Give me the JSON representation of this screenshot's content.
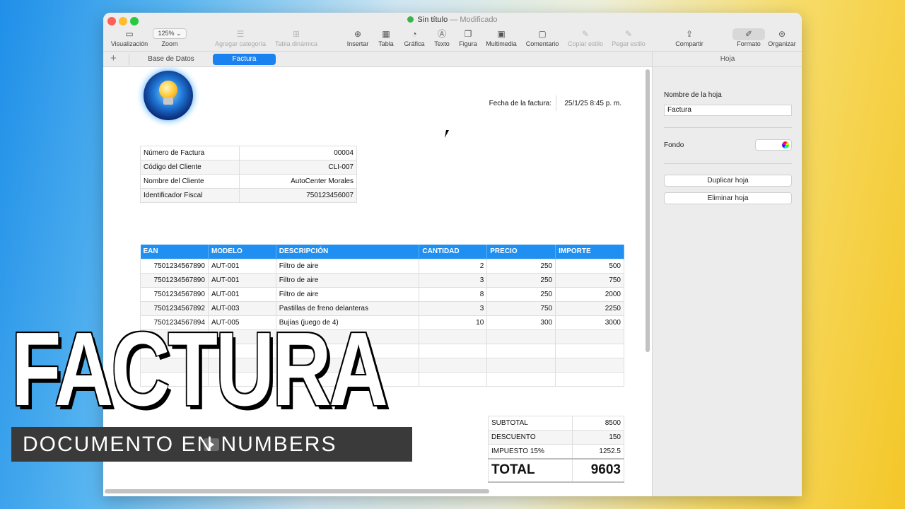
{
  "window": {
    "title": "Sin título",
    "separator": "—",
    "status": "Modificado"
  },
  "toolbar": {
    "view_label": "Visualización",
    "zoom_value": "125%",
    "zoom_label": "Zoom",
    "add_category_label": "Agregar categoría",
    "pivot_label": "Tabla dinámica",
    "insert_label": "Insertar",
    "table_label": "Tabla",
    "chart_label": "Gráfica",
    "text_label": "Texto",
    "shape_label": "Figura",
    "media_label": "Multimedia",
    "comment_label": "Comentario",
    "copy_style_label": "Copiar estilo",
    "paste_style_label": "Pegar estilo",
    "share_label": "Compartir",
    "format_label": "Formato",
    "organize_label": "Organizar"
  },
  "tabs": {
    "add": "+",
    "items": [
      "Base de Datos",
      "Factura"
    ]
  },
  "invoice": {
    "date_label": "Fecha de la factura:",
    "date_value": "25/1/25 8:45 p. m.",
    "info": [
      {
        "label": "Número de Factura",
        "value": "00004"
      },
      {
        "label": "Código del Cliente",
        "value": "CLI-007"
      },
      {
        "label": "Nombre del Cliente",
        "value": "AutoCenter Morales"
      },
      {
        "label": "Identificador Fiscal",
        "value": "750123456007"
      }
    ],
    "columns": [
      "EAN",
      "MODELO",
      "DESCRIPCIÓN",
      "CANTIDAD",
      "PRECIO",
      "IMPORTE"
    ],
    "rows": [
      [
        "7501234567890",
        "AUT-001",
        "Filtro de aire",
        "2",
        "250",
        "500"
      ],
      [
        "7501234567890",
        "AUT-001",
        "Filtro de aire",
        "3",
        "250",
        "750"
      ],
      [
        "7501234567890",
        "AUT-001",
        "Filtro de aire",
        "8",
        "250",
        "2000"
      ],
      [
        "7501234567892",
        "AUT-003",
        "Pastillas de freno delanteras",
        "3",
        "750",
        "2250"
      ],
      [
        "7501234567894",
        "AUT-005",
        "Bujías (juego de 4)",
        "10",
        "300",
        "3000"
      ]
    ],
    "totals": [
      {
        "label": "SUBTOTAL",
        "value": "8500"
      },
      {
        "label": "DESCUENTO",
        "value": "150"
      },
      {
        "label": "IMPUESTO 15%",
        "value": "1252.5"
      }
    ],
    "total_label": "TOTAL",
    "total_value": "9603"
  },
  "sidebar": {
    "title": "Hoja",
    "sheet_name_label": "Nombre de la hoja",
    "sheet_name_value": "Factura",
    "background_label": "Fondo",
    "duplicate_label": "Duplicar hoja",
    "delete_label": "Eliminar hoja"
  },
  "overlay": {
    "title": "FACTURA",
    "subtitle": "DOCUMENTO EN NUMBERS"
  }
}
